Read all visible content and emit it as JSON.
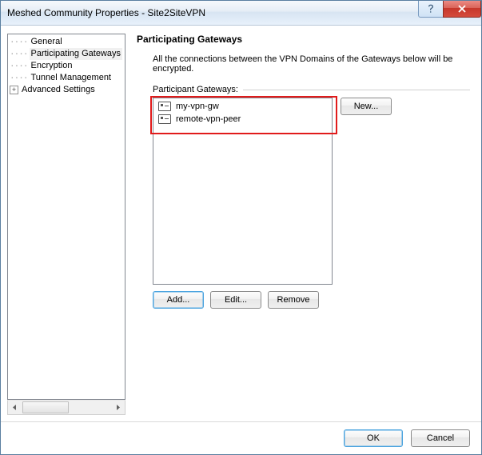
{
  "window": {
    "title": "Meshed Community Properties - Site2SiteVPN"
  },
  "tree": {
    "items": [
      {
        "label": "General",
        "indent": 1,
        "expander": false
      },
      {
        "label": "Participating Gateways",
        "indent": 1,
        "expander": false,
        "selected": true
      },
      {
        "label": "Encryption",
        "indent": 1,
        "expander": false
      },
      {
        "label": "Tunnel Management",
        "indent": 1,
        "expander": false
      },
      {
        "label": "Advanced Settings",
        "indent": 0,
        "expander": true
      }
    ]
  },
  "panel": {
    "heading": "Participating Gateways",
    "description": "All the connections between the VPN Domains of the Gateways below will be encrypted.",
    "list_label": "Participant Gateways:",
    "items": [
      {
        "name": "my-vpn-gw"
      },
      {
        "name": "remote-vpn-peer"
      }
    ],
    "buttons": {
      "new": "New...",
      "add": "Add...",
      "edit": "Edit...",
      "remove": "Remove"
    }
  },
  "footer": {
    "ok": "OK",
    "cancel": "Cancel"
  }
}
